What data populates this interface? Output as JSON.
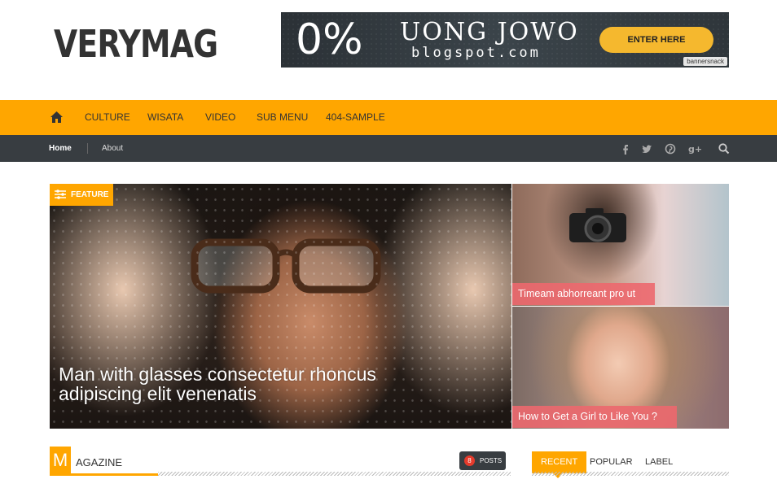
{
  "site": {
    "logo": "VERYMAG"
  },
  "banner": {
    "big_text": "0%",
    "brand": "UONG JOWO",
    "sub": "blogspot.com",
    "cta": "ENTER HERE",
    "tag": "bannersnack"
  },
  "mainnav": {
    "home_icon": "home-icon",
    "items": [
      "CULTURE",
      "WISATA",
      "VIDEO",
      "SUB MENU",
      "404-SAMPLE"
    ]
  },
  "subnav": {
    "home": "Home",
    "about": "About",
    "social": [
      "f",
      "t",
      "p",
      "g+",
      "search"
    ]
  },
  "featured": {
    "badge": "FEATURE",
    "main_title": "Man with glasses consectetur rhoncus adipiscing elit venenatis",
    "side": [
      {
        "title": "Timeam abhorreant pro ut"
      },
      {
        "title": "How to Get a Girl to Like You ?"
      }
    ]
  },
  "magazine": {
    "initial": "M",
    "rest": "AGAZINE",
    "posts_count": "8",
    "posts_label": "POSTS"
  },
  "tabs": [
    "RECENT",
    "POPULAR",
    "LABEL"
  ],
  "colors": {
    "accent": "#ffa600",
    "dark_bar": "#383d41",
    "label_pink": "#ec686e"
  }
}
